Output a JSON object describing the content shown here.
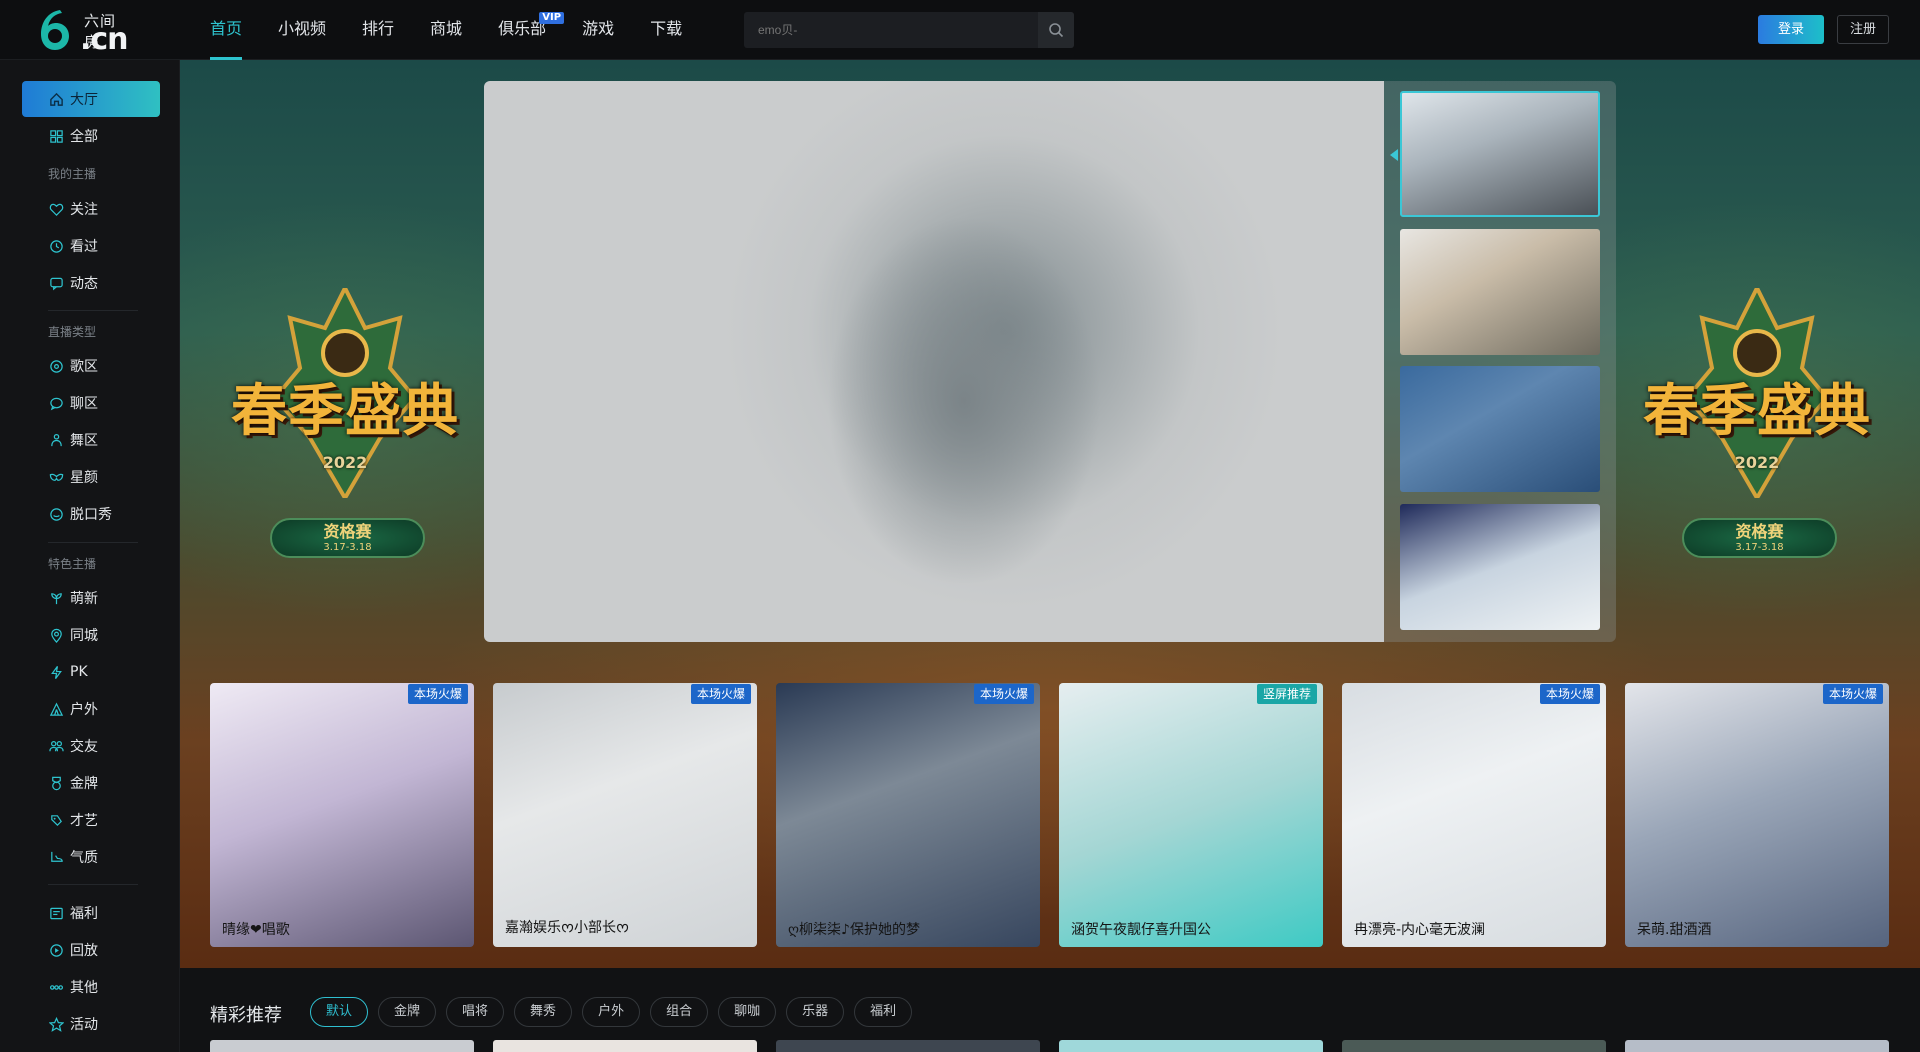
{
  "brand": {
    "logo_top": "六间房",
    "logo_main": ".cn"
  },
  "nav": [
    {
      "label": "首页",
      "active": true
    },
    {
      "label": "小视频"
    },
    {
      "label": "排行"
    },
    {
      "label": "商城"
    },
    {
      "label": "俱乐部",
      "badge": "VIP"
    },
    {
      "label": "游戏"
    },
    {
      "label": "下载"
    }
  ],
  "search": {
    "placeholder": "emo贝-"
  },
  "auth": {
    "login": "登录",
    "register": "注册"
  },
  "sidebar": {
    "top": [
      {
        "label": "大厅",
        "icon": "home-icon",
        "active": true
      },
      {
        "label": "全部",
        "icon": "grid-icon"
      }
    ],
    "groups": [
      {
        "title": "我的主播",
        "items": [
          {
            "label": "关注",
            "icon": "heart-icon"
          },
          {
            "label": "看过",
            "icon": "clock-icon"
          },
          {
            "label": "动态",
            "icon": "message-icon"
          }
        ]
      },
      {
        "title": "直播类型",
        "items": [
          {
            "label": "歌区",
            "icon": "music-icon"
          },
          {
            "label": "聊区",
            "icon": "chat-icon"
          },
          {
            "label": "舞区",
            "icon": "dance-icon"
          },
          {
            "label": "星颜",
            "icon": "mask-icon"
          },
          {
            "label": "脱口秀",
            "icon": "talk-icon"
          }
        ]
      },
      {
        "title": "特色主播",
        "items": [
          {
            "label": "萌新",
            "icon": "sprout-icon"
          },
          {
            "label": "同城",
            "icon": "location-icon"
          },
          {
            "label": "PK",
            "icon": "lightning-icon"
          },
          {
            "label": "户外",
            "icon": "tent-icon"
          },
          {
            "label": "交友",
            "icon": "people-icon"
          },
          {
            "label": "金牌",
            "icon": "medal-icon"
          },
          {
            "label": "才艺",
            "icon": "palette-icon"
          },
          {
            "label": "气质",
            "icon": "shoe-icon"
          }
        ]
      }
    ],
    "extra": [
      {
        "label": "福利",
        "icon": "gift-icon"
      },
      {
        "label": "回放",
        "icon": "replay-icon"
      },
      {
        "label": "其他",
        "icon": "more-icon"
      },
      {
        "label": "活动",
        "icon": "star-icon"
      }
    ]
  },
  "banner": {
    "event_title": "春季盛典",
    "event_year": "2022",
    "event_stage": "资格赛",
    "event_dates": "3.17-3.18",
    "colors": {
      "accent": "#2ec4cf",
      "primary_blue": "#1c66c9"
    }
  },
  "cards": [
    {
      "name": "晴缘❤唱歌",
      "badge": "本场火爆",
      "badge_type": "hot"
    },
    {
      "name": "嘉瀚娱乐ᰔ小部长ᰔ",
      "badge": "本场火爆",
      "badge_type": "hot"
    },
    {
      "name": "ღ柳柒柒♪保护她的梦",
      "badge": "本场火爆",
      "badge_type": "hot"
    },
    {
      "name": "涵贺午夜靓仔喜升国公",
      "badge": "竖屏推荐",
      "badge_type": "vert"
    },
    {
      "name": "冉漂亮-内心毫无波澜",
      "badge": "本场火爆",
      "badge_type": "hot"
    },
    {
      "name": "呆萌.甜酒酒",
      "badge": "本场火爆",
      "badge_type": "hot"
    }
  ],
  "recommend": {
    "title": "精彩推荐",
    "filters": [
      {
        "label": "默认",
        "active": true
      },
      {
        "label": "金牌"
      },
      {
        "label": "唱将"
      },
      {
        "label": "舞秀"
      },
      {
        "label": "户外"
      },
      {
        "label": "组合"
      },
      {
        "label": "聊咖"
      },
      {
        "label": "乐器"
      },
      {
        "label": "福利"
      }
    ]
  }
}
